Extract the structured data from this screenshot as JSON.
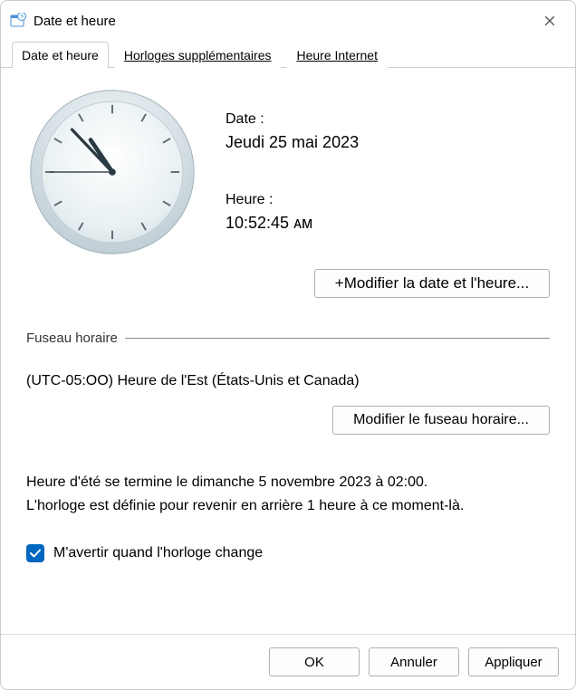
{
  "window": {
    "title": "Date et heure"
  },
  "tabs": [
    {
      "label": "Date et heure",
      "active": true
    },
    {
      "label": "Horloges supplémentaires",
      "active": false
    },
    {
      "label": "Heure Internet",
      "active": false
    }
  ],
  "date": {
    "label": "Date :",
    "value": "Jeudi 25 mai 2023"
  },
  "time": {
    "label": "Heure :",
    "value": "10:52:45 ᴀᴍ"
  },
  "clock": {
    "hour": 10,
    "minute": 52,
    "second": 45
  },
  "buttons": {
    "change_datetime": "+Modifier la date et l'heure...",
    "change_timezone": "Modifier le fuseau horaire..."
  },
  "timezone": {
    "group_label": "Fuseau horaire",
    "value": "(UTC-05:OO) Heure de l'Est (États-Unis et Canada)"
  },
  "dst": {
    "line1": "Heure d'été se termine le dimanche 5 novembre 2023 à 02:00.",
    "line2": "L'horloge est définie pour revenir en arrière 1 heure à ce moment-là."
  },
  "notify": {
    "label": "M'avertir quand l'horloge change",
    "checked": true
  },
  "footer": {
    "ok": "OK",
    "cancel": "Annuler",
    "apply": "Appliquer"
  }
}
